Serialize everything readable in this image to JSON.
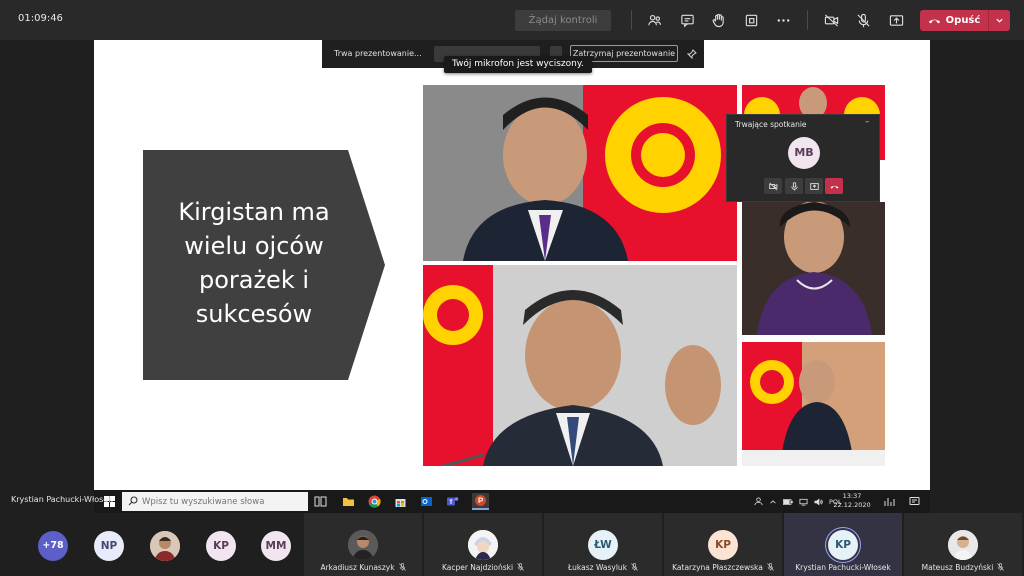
{
  "topbar": {
    "timer": "01:09:46",
    "take_control_label": "Żądaj kontroli",
    "leave_label": "Opuść"
  },
  "slide": {
    "text": "Kirgistan ma wielu ojców porażek i sukcesów"
  },
  "present_bar": {
    "label": "Trwa prezentowanie...",
    "stop_label": "Zatrzymaj prezentowanie",
    "mic_tooltip": "Twój mikrofon jest wyciszony."
  },
  "mini_window": {
    "title": "Trwające spotkanie",
    "minimize": "–",
    "avatar_initials": "MB"
  },
  "taskbar": {
    "search_placeholder": "Wpisz tu wyszukiwane słowa",
    "language": "POL",
    "time": "13:37",
    "date": "22.12.2020"
  },
  "presenter_name": "Krystian Pachucki-Włosek",
  "participants": {
    "overflow": "+78",
    "small": [
      {
        "initials": "NP"
      },
      {
        "initials": ""
      },
      {
        "initials": "KP"
      },
      {
        "initials": "MM"
      }
    ],
    "tiles": [
      {
        "name": "Arkadiusz Kunaszyk",
        "initials": ""
      },
      {
        "name": "Kacper Najdzioński",
        "initials": ""
      },
      {
        "name": "Łukasz Wasyluk",
        "initials": "ŁW"
      },
      {
        "name": "Katarzyna Płaszczewska",
        "initials": "KP"
      },
      {
        "name": "Krystian Pachucki-Włosek",
        "initials": "KP"
      },
      {
        "name": "Mateusz Budzyński",
        "initials": ""
      }
    ]
  },
  "colors": {
    "leave": "#c4314b",
    "background": "#1f1f1f",
    "slide_shape": "#404040",
    "flag_red": "#e8112d",
    "flag_yellow": "#ffd200"
  }
}
